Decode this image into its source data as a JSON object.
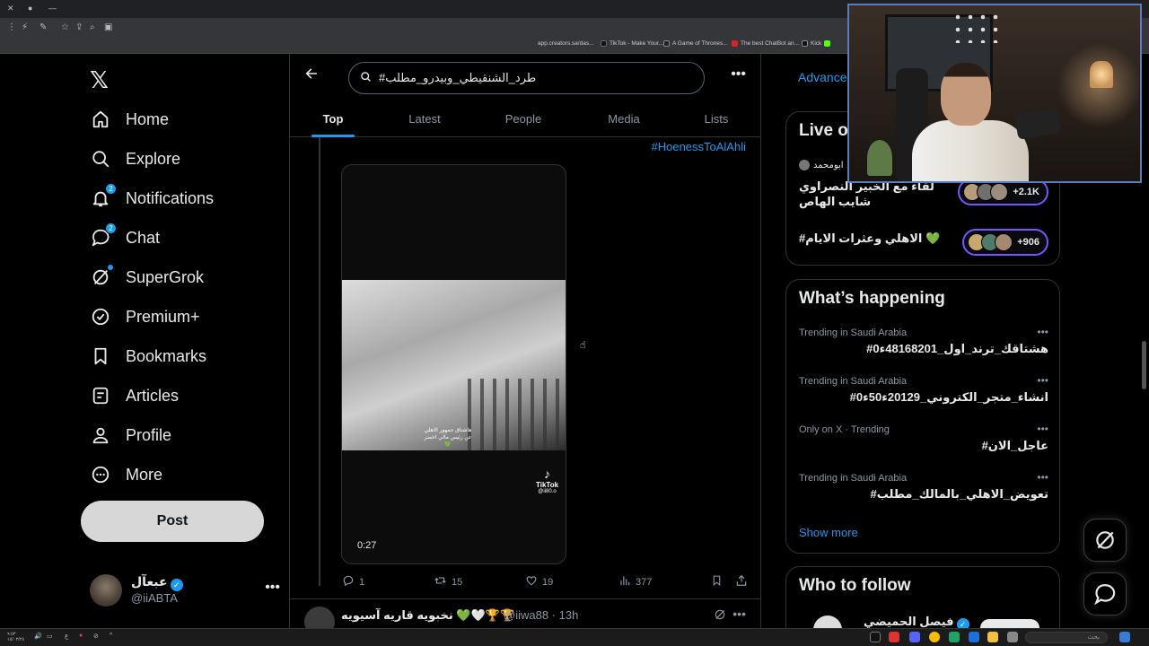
{
  "browser": {
    "bookmarks": [
      "app.creators.sa/das...",
      "TikTok - Make Your...",
      "A Game of Thrones...",
      "The best ChatBot an...",
      "Kick"
    ]
  },
  "nav": {
    "items": [
      {
        "label": "Home",
        "icon": "home-icon"
      },
      {
        "label": "Explore",
        "icon": "search-icon"
      },
      {
        "label": "Notifications",
        "icon": "bell-icon",
        "badge": "2"
      },
      {
        "label": "Chat",
        "icon": "chat-icon",
        "badge": "2"
      },
      {
        "label": "SuperGrok",
        "icon": "grok-icon"
      },
      {
        "label": "Premium+",
        "icon": "verified-badge-icon"
      },
      {
        "label": "Bookmarks",
        "icon": "bookmark-icon"
      },
      {
        "label": "Articles",
        "icon": "article-icon"
      },
      {
        "label": "Profile",
        "icon": "person-icon"
      },
      {
        "label": "More",
        "icon": "more-circle-icon"
      }
    ],
    "post_label": "Post",
    "account": {
      "name": "عبعآل",
      "handle": "@iiABTA"
    }
  },
  "search": {
    "query": "#طرد_الشنقيطي_وبيدرو_مطلب"
  },
  "tabs": [
    "Top",
    "Latest",
    "People",
    "Media",
    "Lists"
  ],
  "tweet": {
    "hashtag": "#HoenessToAlAhli",
    "video_duration": "0:27",
    "video_caption": "هاشتاق جمهور الاهلي عن رئيس مالي اخضر 💚",
    "tiktok_label": "TikTok",
    "tiktok_handle": "@ii80.o",
    "replies": "1",
    "reposts": "15",
    "likes": "19",
    "views": "377"
  },
  "next_tweet": {
    "name": "نخبويه قاريه آسيويه 💚🤍🏆🏆",
    "handle": "@iiwa88",
    "time": "13h"
  },
  "right": {
    "advanced_label": "Advance",
    "live_title": "Live o",
    "live_host": "ابومحمد",
    "live_items": [
      {
        "title": "لقاء مع الخبير النصراوي شايب الهاص",
        "count": "+2.1K"
      },
      {
        "title": "#الاهلي وعثرات الايام 💚",
        "count": "+906"
      }
    ],
    "happening_title": "What’s happening",
    "trends": [
      {
        "context": "Trending in Saudi Arabia",
        "name": "#هشتاقك_ترند_اول_48168201ء0"
      },
      {
        "context": "Trending in Saudi Arabia",
        "name": "#انشاء_متجر_الكتروني_20129ء50ء0"
      },
      {
        "context": "Only on X · Trending",
        "name": "#عاجل_الان"
      },
      {
        "context": "Trending in Saudi Arabia",
        "name": "#تعويض_الاهلي_بالمالك_مطلب"
      }
    ],
    "show_more": "Show more",
    "who_to_follow": "Who to follow",
    "follow_name": "فيصل الحميضي"
  },
  "taskbar": {
    "search_placeholder": "بحث",
    "clock_time": "٩:٥٣",
    "clock_date": "١٥/٠٣/٢٥"
  }
}
